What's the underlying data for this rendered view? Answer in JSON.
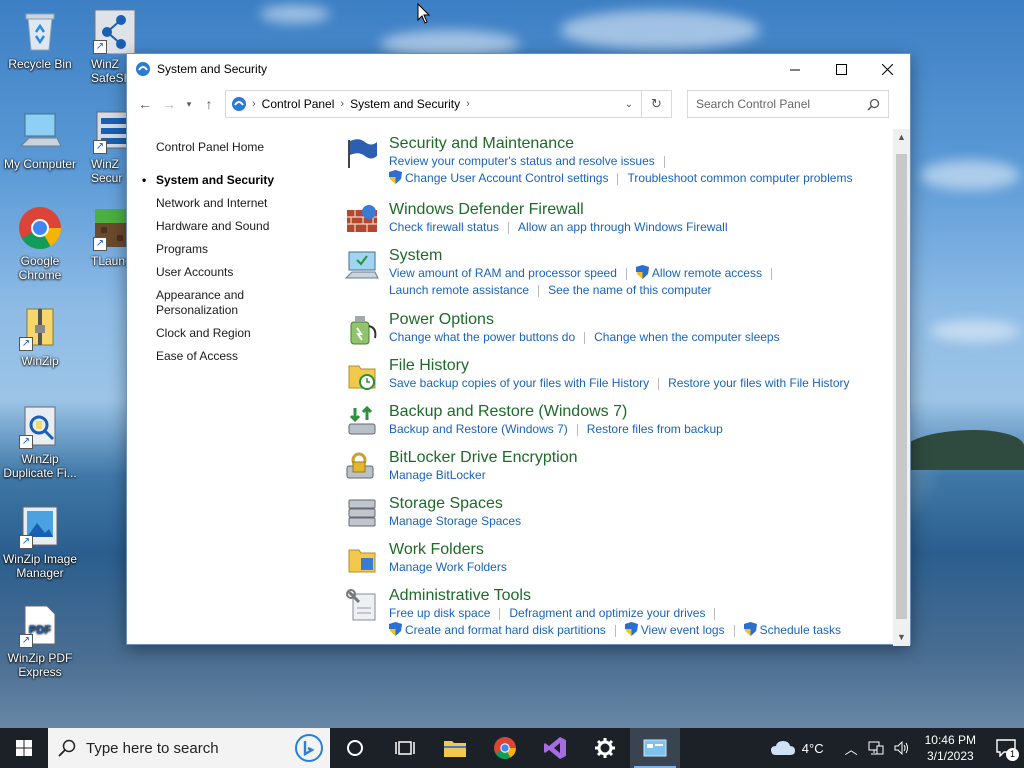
{
  "desktop": {
    "icons": [
      {
        "label": "Recycle Bin"
      },
      {
        "label": "WinZip SafeShare"
      },
      {
        "label": "My Computer"
      },
      {
        "label": "WinZip System Security"
      },
      {
        "label": "Google Chrome"
      },
      {
        "label": "TLauncher"
      },
      {
        "label": "WinZip"
      },
      {
        "label": "WinZip Duplicate Fi..."
      },
      {
        "label": "WinZip Image Manager"
      },
      {
        "label": "WinZip PDF Express"
      }
    ],
    "partial_labels": {
      "safeshare": "WinZ SafeSh",
      "syssec": "WinZ Secur",
      "tlauncher": "TLaunc"
    }
  },
  "window": {
    "title": "System and Security",
    "breadcrumb": [
      "Control Panel",
      "System and Security"
    ],
    "search_placeholder": "Search Control Panel",
    "left_nav": [
      "Control Panel Home",
      "System and Security",
      "Network and Internet",
      "Hardware and Sound",
      "Programs",
      "User Accounts",
      "Appearance and Personalization",
      "Clock and Region",
      "Ease of Access"
    ],
    "categories": [
      {
        "title": "Security and Maintenance",
        "lines": [
          [
            "Review your computer's status and resolve issues"
          ],
          [
            "Change User Account Control settings",
            "Troubleshoot common computer problems"
          ]
        ]
      },
      {
        "title": "Windows Defender Firewall",
        "lines": [
          [
            "Check firewall status",
            "Allow an app through Windows Firewall"
          ]
        ]
      },
      {
        "title": "System",
        "lines": [
          [
            "View amount of RAM and processor speed",
            "Allow remote access"
          ],
          [
            "Launch remote assistance",
            "See the name of this computer"
          ]
        ]
      },
      {
        "title": "Power Options",
        "lines": [
          [
            "Change what the power buttons do",
            "Change when the computer sleeps"
          ]
        ]
      },
      {
        "title": "File History",
        "lines": [
          [
            "Save backup copies of your files with File History",
            "Restore your files with File History"
          ]
        ]
      },
      {
        "title": "Backup and Restore (Windows 7)",
        "lines": [
          [
            "Backup and Restore (Windows 7)",
            "Restore files from backup"
          ]
        ]
      },
      {
        "title": "BitLocker Drive Encryption",
        "lines": [
          [
            "Manage BitLocker"
          ]
        ]
      },
      {
        "title": "Storage Spaces",
        "lines": [
          [
            "Manage Storage Spaces"
          ]
        ]
      },
      {
        "title": "Work Folders",
        "lines": [
          [
            "Manage Work Folders"
          ]
        ]
      },
      {
        "title": "Administrative Tools",
        "lines": [
          [
            "Free up disk space",
            "Defragment and optimize your drives"
          ],
          [
            "Create and format hard disk partitions",
            "View event logs",
            "Schedule tasks"
          ]
        ]
      }
    ]
  },
  "taskbar": {
    "search_placeholder": "Type here to search",
    "temperature": "4°C",
    "time": "10:46 PM",
    "date": "3/1/2023",
    "notifications": "1"
  },
  "colors": {
    "link": "#1a63b8",
    "heading": "#1d6a29",
    "taskbar": "#1c2128"
  }
}
